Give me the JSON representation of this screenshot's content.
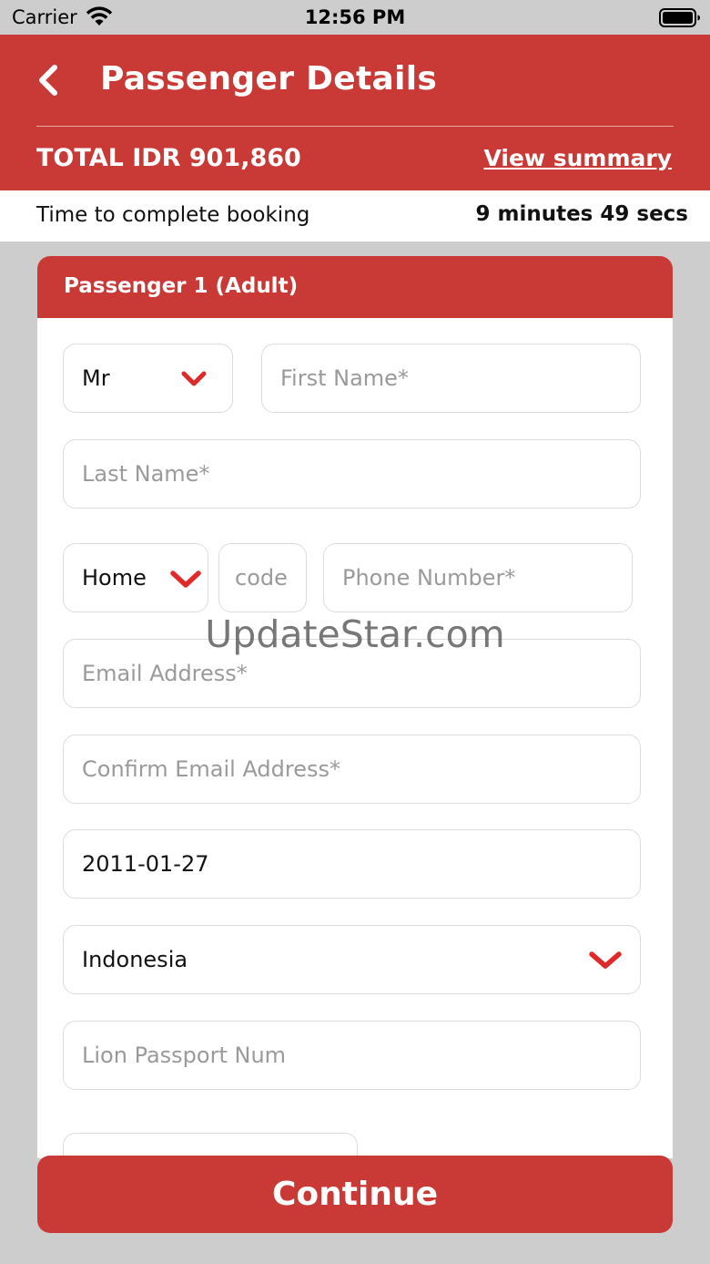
{
  "status_bar": {
    "carrier": "Carrier",
    "time": "12:56 PM",
    "wifi_icon": "wifi-icon",
    "battery_icon": "battery-icon"
  },
  "header": {
    "back_icon": "chevron-left-icon",
    "title": "Passenger Details",
    "total": "TOTAL IDR 901,860",
    "view_summary": "View summary",
    "background_color": "#c93a36"
  },
  "timer": {
    "label": "Time to complete booking",
    "value": "9 minutes 49 secs"
  },
  "passenger_card": {
    "title": "Passenger 1 (Adult)",
    "title_select": {
      "value": "Mr"
    },
    "first_name": {
      "value": "",
      "placeholder": "First Name*"
    },
    "last_name": {
      "value": "",
      "placeholder": "Last Name*"
    },
    "phone_type_select": {
      "value": "Home"
    },
    "country_code": {
      "value": "",
      "placeholder": "code"
    },
    "phone_number": {
      "value": "",
      "placeholder": "Phone Number*"
    },
    "email": {
      "value": "",
      "placeholder": "Email Address*"
    },
    "confirm_email": {
      "value": "",
      "placeholder": "Confirm Email Address*"
    },
    "date_of_birth": {
      "value": "2011-01-27"
    },
    "nationality_select": {
      "value": "Indonesia"
    },
    "lion_passport": {
      "value": "",
      "placeholder": "Lion Passport Num"
    },
    "chevron_color": "#e02a2a"
  },
  "watermark": "UpdateStar.com",
  "continue_button": "Continue"
}
